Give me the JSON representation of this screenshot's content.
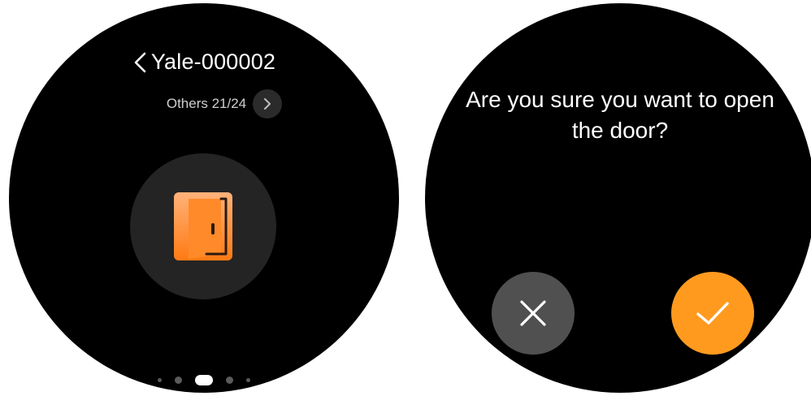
{
  "left_screen": {
    "back_icon": "chevron-left-icon",
    "device_name": "Yale-000002",
    "category_label": "Others 21/24",
    "next_icon": "chevron-right-icon",
    "door_icon": "door-open-icon",
    "page_indicator": {
      "count": 5,
      "active_index": 2
    }
  },
  "right_screen": {
    "question": "Are you sure you want to open the door?",
    "cancel_icon": "close-icon",
    "confirm_icon": "check-icon"
  },
  "colors": {
    "background": "#000000",
    "accent_orange": "#ff9a1f",
    "cancel_gray": "#505050",
    "door_gradient_top": "#ffb27a",
    "door_gradient_bottom": "#ff7a12"
  }
}
